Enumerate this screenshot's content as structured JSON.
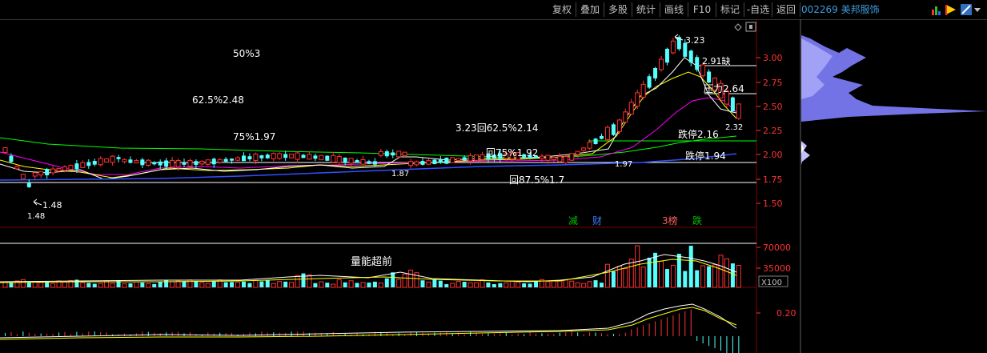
{
  "toolbar": {
    "buttons": [
      "复权",
      "叠加",
      "多股",
      "统计",
      "画线",
      "F10",
      "标记",
      "-自选",
      "返回"
    ],
    "stock_title": "002269 美邦服饰"
  },
  "main_chart": {
    "annotations": {
      "fib_50": "50%3",
      "fib_62": "62.5%2.48",
      "fib_75": "75%1.97",
      "ret_62": "3.23回62.5%2.14",
      "ret_75": "回75%1.92",
      "ret_87": "回87.5%1.7",
      "high": "3.23",
      "gap": "2.91缺",
      "pressure": "压力2.64",
      "last_low": "2.32",
      "limit_down_1": "跌停2.16",
      "limit_down_2": "跌停1.94",
      "low_marker": "1.48",
      "low_value": "1.48",
      "mid_low": "1.87",
      "mid_low_2": "1.97"
    },
    "y_axis": [
      "3.00",
      "2.75",
      "2.50",
      "2.25",
      "2.00",
      "1.75",
      "1.50"
    ],
    "event_tags": [
      {
        "text": "减",
        "color": "#00c000"
      },
      {
        "text": "财",
        "color": "#3c7cff"
      },
      {
        "text": "3榜",
        "color": "#ff6060"
      },
      {
        "text": "跌",
        "color": "#00c000"
      }
    ]
  },
  "volume_chart": {
    "annotation": "量能超前",
    "y_axis": [
      "70000",
      "35000"
    ],
    "unit": "X100"
  },
  "indicator_chart": {
    "y_axis": [
      "0.20"
    ]
  },
  "colors": {
    "up": "#ff3232",
    "down": "#54ffff",
    "ma5": "#ffffff",
    "ma10": "#ffff00",
    "ma20": "#ff00ff",
    "ma60": "#00ff00",
    "ma120": "#3050ff",
    "profile": "#8080ff"
  }
}
